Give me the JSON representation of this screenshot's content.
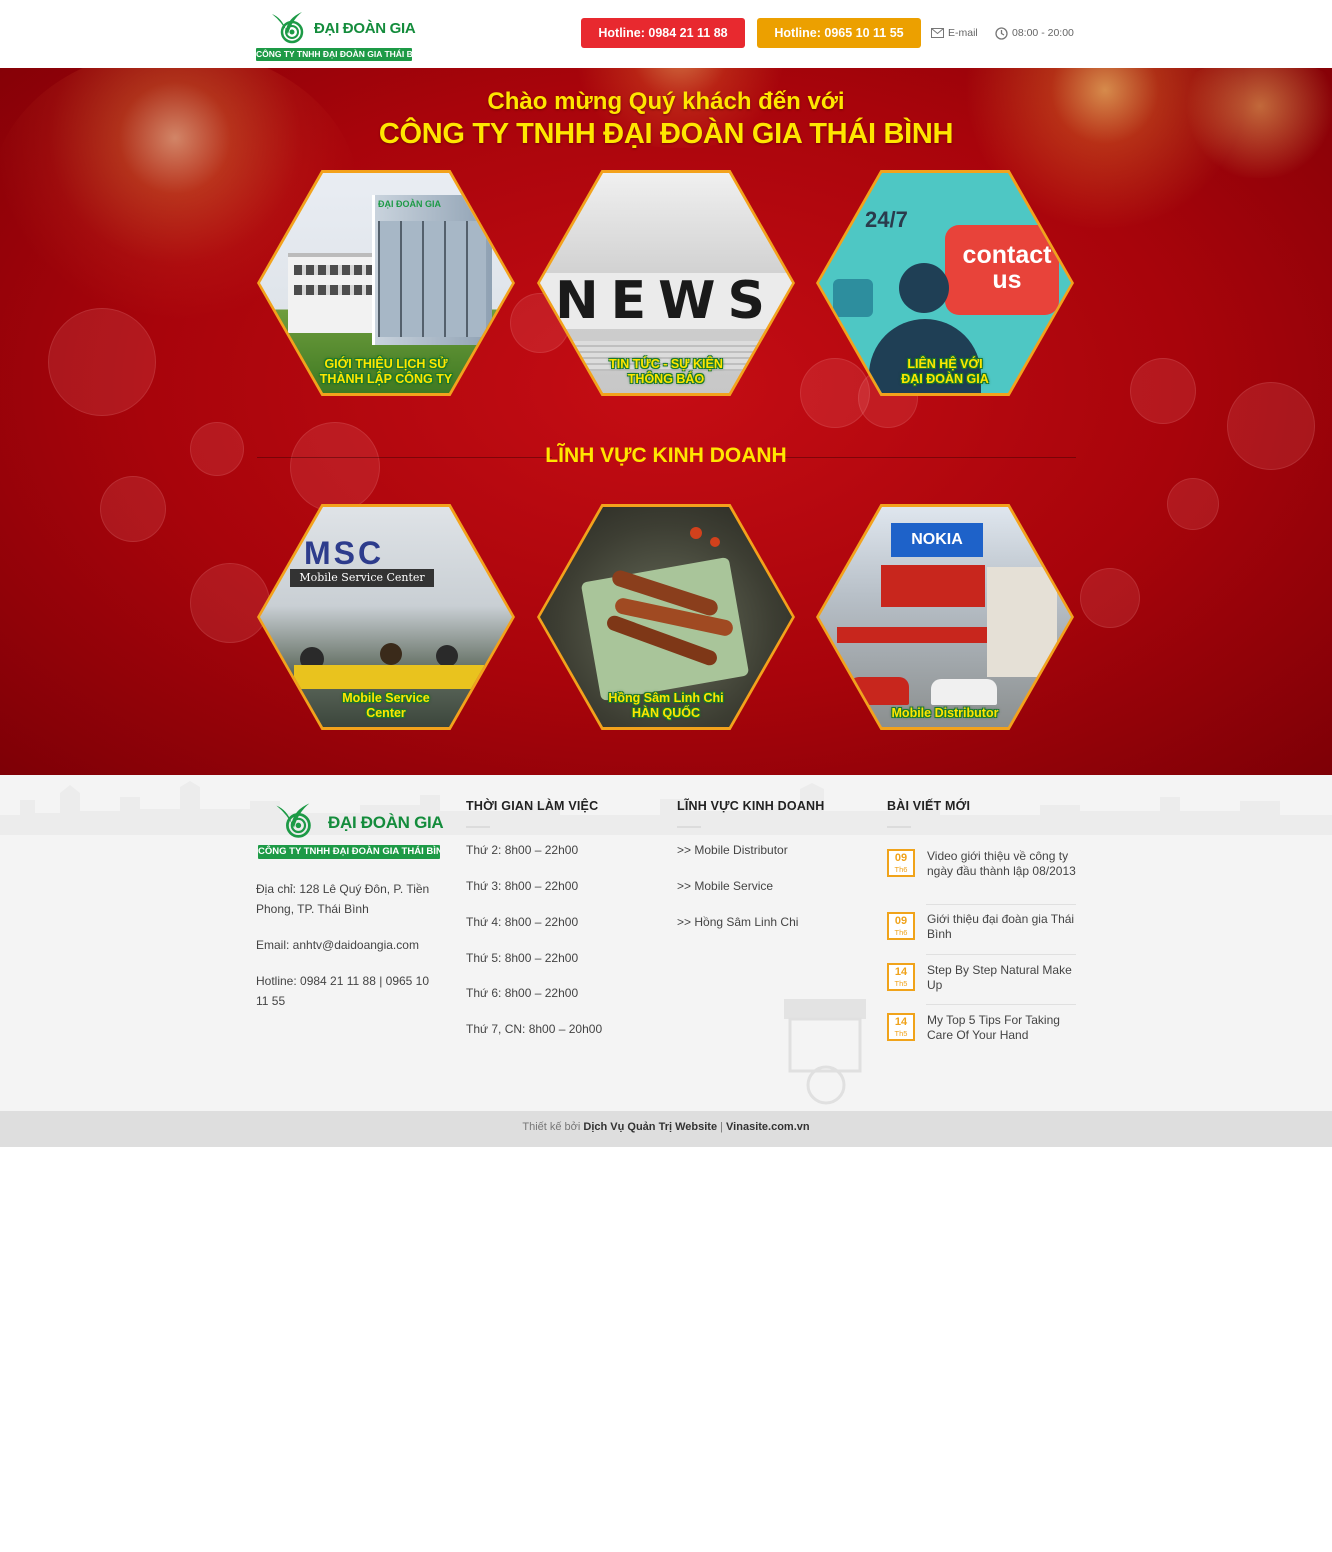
{
  "header": {
    "logo_brand": "ĐẠI ĐOÀN GIA",
    "logo_tagline": "CÔNG TY TNHH ĐẠI ĐOÀN GIA THÁI BÌNH",
    "hotline1": "Hotline: 0984 21 11 88",
    "hotline2": "Hotline: 0965 10 11 55",
    "email_label": "E-mail",
    "hours": "08:00 - 20:00"
  },
  "hero": {
    "welcome_line1": "Chào mừng Quý khách đến với",
    "welcome_line2": "CÔNG TY TNHH ĐẠI ĐOÀN GIA THÁI BÌNH",
    "tiles": [
      {
        "line1": "GIỚI THIỆU LỊCH SỬ",
        "line2": "THÀNH LẬP CÔNG TY",
        "sign": "ĐẠI ĐOÀN GIA"
      },
      {
        "line1": "TIN TỨC - SỰ KIỆN",
        "line2": "THÔNG BÁO",
        "word": "NEWS"
      },
      {
        "line1": "LIÊN HỆ VỚI",
        "line2": "ĐẠI ĐOÀN GIA",
        "badge": "24/7",
        "bubble1": "contact",
        "bubble2": "us"
      }
    ],
    "section_title": "LĨNH VỰC KINH DOANH",
    "business": [
      {
        "line1": "Mobile Service",
        "line2": "Center",
        "sign1": "MSC",
        "sign2": "Mobile Service Center"
      },
      {
        "line1": "Hồng Sâm Linh Chi",
        "line2": "HÀN QUỐC"
      },
      {
        "line1": "Mobile Distributor",
        "line2": "",
        "sign": "NOKIA"
      }
    ]
  },
  "footer": {
    "logo_brand": "ĐẠI ĐOÀN GIA",
    "logo_tagline": "CÔNG TY TNHH ĐẠI ĐOÀN GIA THÁI BÌNH",
    "address": "Địa chỉ: 128 Lê Quý Đôn, P. Tiền Phong, TP. Thái Bình",
    "email": "Email: anhtv@daidoangia.com",
    "hotline": "Hotline: 0984 21 11 88 | 0965 10 11 55",
    "hours_title": "THỜI GIAN LÀM VIỆC",
    "hours": [
      "Thứ 2: 8h00 – 22h00",
      "Thứ 3: 8h00 – 22h00",
      "Thứ 4: 8h00 – 22h00",
      "Thứ 5: 8h00 – 22h00",
      "Thứ 6: 8h00 – 22h00",
      "Thứ 7, CN: 8h00 – 20h00"
    ],
    "business_title": "LĨNH VỰC KINH DOANH",
    "business_links": [
      ">> Mobile Distributor",
      ">> Mobile Service",
      ">> Hồng Sâm Linh Chi"
    ],
    "posts_title": "BÀI VIẾT MỚI",
    "posts": [
      {
        "day": "09",
        "month": "Th6",
        "title": "Video giới thiệu về công ty ngày đầu thành lập 08/2013"
      },
      {
        "day": "09",
        "month": "Th6",
        "title": "Giới thiệu đại đoàn gia Thái Bình"
      },
      {
        "day": "14",
        "month": "Th5",
        "title": "Step By Step Natural Make Up"
      },
      {
        "day": "14",
        "month": "Th5",
        "title": "My Top 5 Tips For Taking Care Of Your Hand"
      }
    ]
  },
  "bottom_bar": {
    "prefix": "Thiết kế bởi",
    "service": "Dịch Vụ Quản Trị Website",
    "separator": "|",
    "site": "Vinasite.com.vn"
  },
  "colors": {
    "hotline1": "#e8292f",
    "hotline2": "#eca000",
    "hero_red": "#b0050c",
    "title_yellow": "#ffe600",
    "brand_green": "#148c3c",
    "date_orange": "#f0a31a"
  }
}
